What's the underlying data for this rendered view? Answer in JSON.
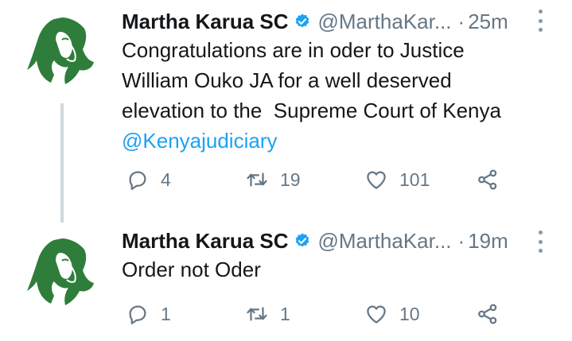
{
  "colors": {
    "accent": "#1da1f2",
    "muted": "#657786",
    "text": "#14171a",
    "thread_line": "#cfd9de",
    "avatar_green": "#2f7d3a"
  },
  "tweets": [
    {
      "author_name": "Martha Karua SC",
      "handle": "@MarthaKar...",
      "separator": "·",
      "time": "25m",
      "text_line1": "Congratulations are in oder to Justice",
      "text_line2": "William Ouko JA for a well deserved",
      "text_line3": "elevation to the  Supreme Court of Kenya",
      "mention": "@Kenyajudiciary",
      "replies": "4",
      "retweets": "19",
      "likes": "101",
      "icons": [
        "reply-icon",
        "retweet-icon",
        "like-icon",
        "share-icon"
      ]
    },
    {
      "author_name": "Martha Karua SC",
      "handle": "@MarthaKar...",
      "separator": "·",
      "time": "19m",
      "text_line1": "Order not Oder",
      "replies": "1",
      "retweets": "1",
      "likes": "10",
      "icons": [
        "reply-icon",
        "retweet-icon",
        "like-icon",
        "share-icon"
      ]
    }
  ]
}
